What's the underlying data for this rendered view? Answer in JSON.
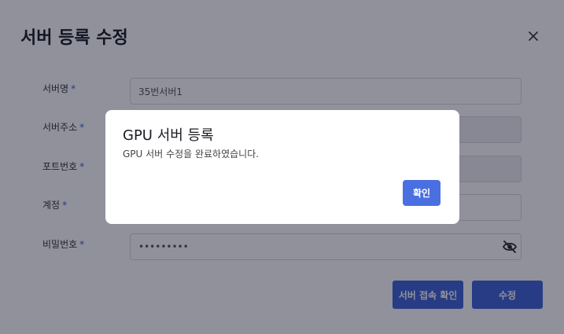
{
  "modal": {
    "title": "서버 등록 수정",
    "fields": [
      {
        "label": "서버명",
        "value": "35번서버1"
      },
      {
        "label": "서버주소",
        "value": ""
      },
      {
        "label": "포트번호",
        "value": ""
      },
      {
        "label": "계정",
        "value": ""
      },
      {
        "label": "비밀번호",
        "value": "•••••••••"
      }
    ],
    "required_mark": "*",
    "buttons": {
      "test_connection": "서버 접속 확인",
      "submit": "수정"
    }
  },
  "alert": {
    "title": "GPU 서버 등록",
    "message": "GPU 서버 수정을 완료하였습니다.",
    "confirm": "확인"
  },
  "colors": {
    "primary": "#3f62d6",
    "overlay": "rgba(12,16,38,0.46)"
  },
  "icons": {
    "close": "close-icon",
    "password_visibility": "eye-off-icon"
  }
}
